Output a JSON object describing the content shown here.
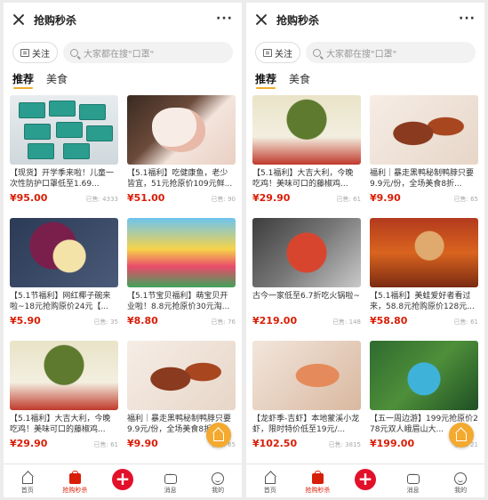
{
  "left": {
    "title": "抢购秒杀",
    "more": "···",
    "follow_label": "关注",
    "search_placeholder": "大家都在搜\"口罩\"",
    "tabs": [
      "推荐",
      "美食"
    ],
    "cards": [
      {
        "title": "【现货】开学季来啦！儿童一次性防护口罩低至1.69...",
        "price": "¥95.00",
        "sold": "已售: 4333"
      },
      {
        "title": "【5.1福利】吃健康鱼，老少皆宜，51元抢原价109元鲜...",
        "price": "¥51.00",
        "sold": "已售: 90"
      },
      {
        "title": "【5.1节福利】网红椰子碗来啦~18元抢购原价24元【...",
        "price": "¥5.90",
        "sold": "已售: 35"
      },
      {
        "title": "【5.1节宝贝福利】萌宝贝开业啦！8.8元抢原价30元淘...",
        "price": "¥8.80",
        "sold": "已售: 76"
      },
      {
        "title": "【5.1福利】大吉大利，今晚吃鸡！美味可口的藤椒鸡...",
        "price": "¥29.90",
        "sold": "已售: 61"
      },
      {
        "title": "福利｜暴走黑鸭秘制鸭脖只要9.9元/份，全场美食8折...",
        "price": "¥9.90",
        "sold": "已售: 65"
      }
    ]
  },
  "right": {
    "title": "抢购秒杀",
    "more": "···",
    "follow_label": "关注",
    "search_placeholder": "大家都在搜\"口罩\"",
    "tabs": [
      "推荐",
      "美食"
    ],
    "cards": [
      {
        "title": "【5.1福利】大吉大利，今晚吃鸡！美味可口的藤椒鸡...",
        "price": "¥29.90",
        "sold": "已售: 61"
      },
      {
        "title": "福利｜暴走黑鸭秘制鸭脖只要9.9元/份，全场美食8折...",
        "price": "¥9.90",
        "sold": "已售: 65"
      },
      {
        "title": "古今一家低至6.7折吃火锅啦~",
        "price": "¥219.00",
        "sold": "已售: 148"
      },
      {
        "title": "【5.1福利】美蛙爱好者看过来，58.8元抢购原价128元...",
        "price": "¥58.80",
        "sold": "已售: 61"
      },
      {
        "title": "【龙虾季-吉虾】本地蒙溪小龙虾，限时特价低至19元/...",
        "price": "¥102.50",
        "sold": "已售: 3815"
      },
      {
        "title": "【五一周边游】199元抢原价278元双人峨眉山大...",
        "price": "¥199.00",
        "sold": "已售: 21"
      }
    ]
  },
  "tabbar": {
    "home": "首页",
    "flash": "抢购秒杀",
    "plus": "+",
    "messages": "消息",
    "me": "我的"
  }
}
